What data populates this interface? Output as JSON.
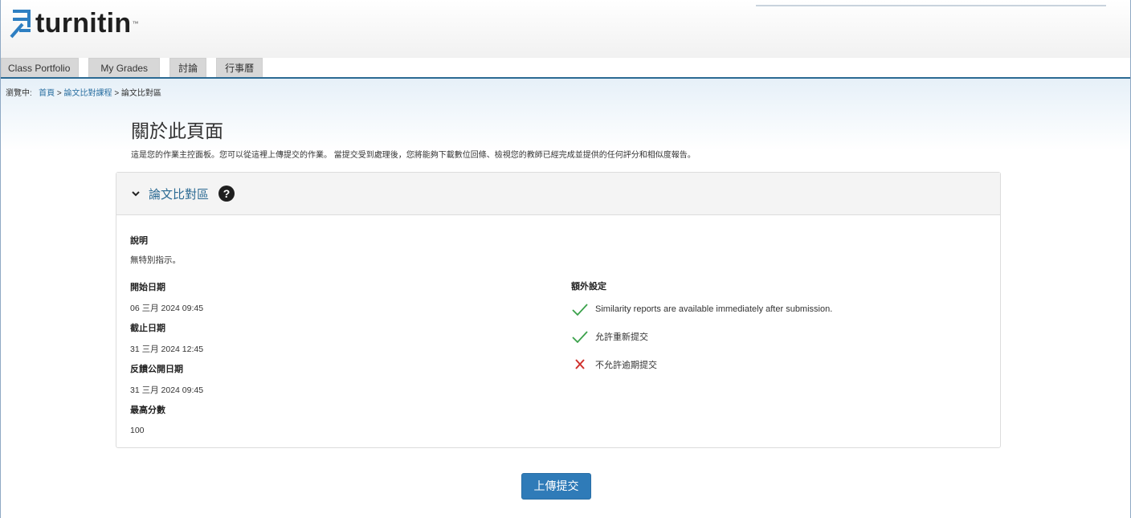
{
  "brand": {
    "name": "turnitin",
    "tm": "™"
  },
  "tabs": [
    {
      "label": "Class Portfolio"
    },
    {
      "label": "My Grades"
    },
    {
      "label": "討論"
    },
    {
      "label": "行事曆"
    }
  ],
  "breadcrumb": {
    "prefix": "瀏覽中:",
    "items": [
      "首頁",
      "論文比對課程",
      "論文比對區"
    ],
    "separator": ">"
  },
  "page": {
    "title": "關於此頁面",
    "description": "這是您的作業主控面板。您可以從這裡上傳提交的作業。 當提交受到處理後，您將能夠下載數位回條、檢視您的教師已經完成並提供的任何評分和相似度報告。"
  },
  "panel": {
    "title": "論文比對區",
    "help_icon": "?",
    "fields": {
      "instructions_label": "說明",
      "instructions_value": "無特別指示。",
      "start_label": "開始日期",
      "start_value": "06 三月 2024 09:45",
      "due_label": "截止日期",
      "due_value": "31 三月 2024 12:45",
      "feedback_label": "反饋公開日期",
      "feedback_value": "31 三月 2024 09:45",
      "max_label": "最高分數",
      "max_value": "100"
    },
    "extra": {
      "title": "額外設定",
      "settings": [
        {
          "text": "Similarity reports are available immediately after submission.",
          "icon": "check-icon"
        },
        {
          "text": "允許重新提交",
          "icon": "check-icon"
        },
        {
          "text": "不允許逾期提交",
          "icon": "cross-icon"
        }
      ]
    }
  },
  "actions": {
    "upload_label": "上傳提交"
  },
  "colors": {
    "accent": "#2f7bb8",
    "check": "#3aa14a",
    "cross": "#d0312d",
    "tabline": "#2b6a93"
  }
}
